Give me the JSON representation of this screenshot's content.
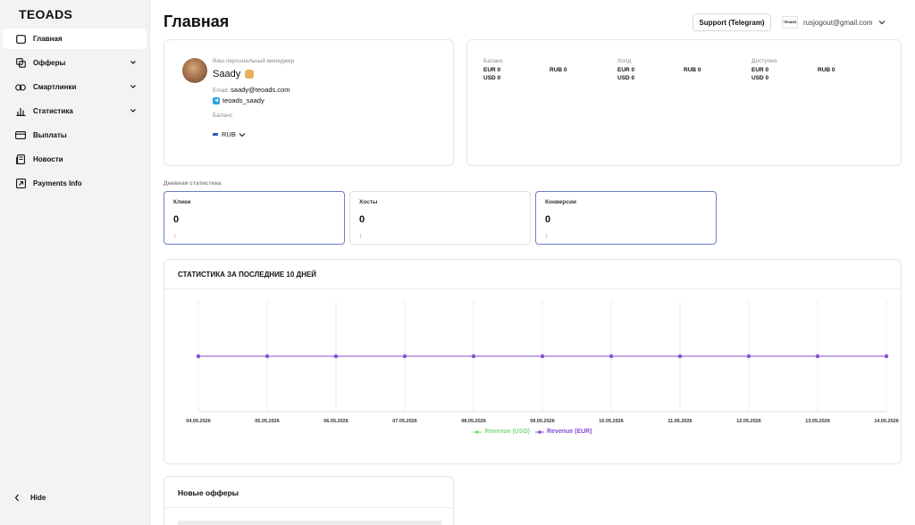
{
  "sidebar": {
    "logo": "TEOADS",
    "items": [
      {
        "label": "Главная",
        "icon": "home-icon",
        "active": true,
        "expandable": false
      },
      {
        "label": "Офферы",
        "icon": "offers-icon",
        "active": false,
        "expandable": true
      },
      {
        "label": "Смартлинки",
        "icon": "link-icon",
        "active": false,
        "expandable": true
      },
      {
        "label": "Статистика",
        "icon": "chart-icon",
        "active": false,
        "expandable": true
      },
      {
        "label": "Выплаты",
        "icon": "card-icon",
        "active": false,
        "expandable": false
      },
      {
        "label": "Новости",
        "icon": "news-icon",
        "active": false,
        "expandable": false
      },
      {
        "label": "Payments Info",
        "icon": "external-icon",
        "active": false,
        "expandable": false
      }
    ],
    "hide_label": "Hide"
  },
  "header": {
    "title": "Главная",
    "support_label": "Support (Telegram)",
    "account_logo": "TEOADS",
    "account_email": "rusjogout@gmail.com"
  },
  "manager": {
    "caption": "Ваш персональный менеджер",
    "name": "Saady",
    "email_label": "Email:",
    "email": "saady@teoads.com",
    "telegram": "teoads_saady",
    "balance_caption": "Баланс",
    "currency": "RUB"
  },
  "balances": [
    {
      "title": "Баланс",
      "rows": [
        [
          "EUR 0",
          "RUB 0"
        ],
        [
          "USD 0",
          ""
        ]
      ]
    },
    {
      "title": "Холд",
      "rows": [
        [
          "EUR 0",
          "RUB 0"
        ],
        [
          "USD 0",
          ""
        ]
      ]
    },
    {
      "title": "Доступно",
      "rows": [
        [
          "EUR 0",
          "RUB 0"
        ],
        [
          "USD 0",
          ""
        ]
      ]
    }
  ],
  "daily": {
    "label": "Дневная статистика",
    "cards": [
      {
        "title": "Клики",
        "value": "0",
        "arrow": "↓",
        "highlighted": true
      },
      {
        "title": "Хосты",
        "value": "0",
        "arrow": "↓",
        "highlighted": false
      },
      {
        "title": "Конверсии",
        "value": "0",
        "arrow": "↓",
        "highlighted": true
      }
    ]
  },
  "chart_section": {
    "title": "СТАТИСТИКА ЗА ПОСЛЕДНИЕ 10 ДНЕЙ"
  },
  "chart_data": {
    "type": "line",
    "categories": [
      "04.05.2026",
      "05.05.2026",
      "06.05.2026",
      "07.05.2026",
      "08.05.2026",
      "09.05.2026",
      "10.05.2026",
      "11.05.2026",
      "12.05.2026",
      "13.05.2026",
      "14.05.2026"
    ],
    "series": [
      {
        "name": "Revenue (USD)",
        "color": "#7ed87e",
        "values": [
          0,
          0,
          0,
          0,
          0,
          0,
          0,
          0,
          0,
          0,
          0
        ]
      },
      {
        "name": "Revenue (EUR)",
        "color": "#8a4fd8",
        "values": [
          0,
          0,
          0,
          0,
          0,
          0,
          0,
          0,
          0,
          0,
          0
        ]
      }
    ],
    "legend": "bottom-center",
    "grid": true
  },
  "offers": {
    "title": "Новые офферы"
  },
  "colors": {
    "accent_purple": "#8a4fd8",
    "accent_green": "#7ed87e",
    "down_arrow": "#e05050",
    "highlight_border": "#6f7fc0"
  }
}
